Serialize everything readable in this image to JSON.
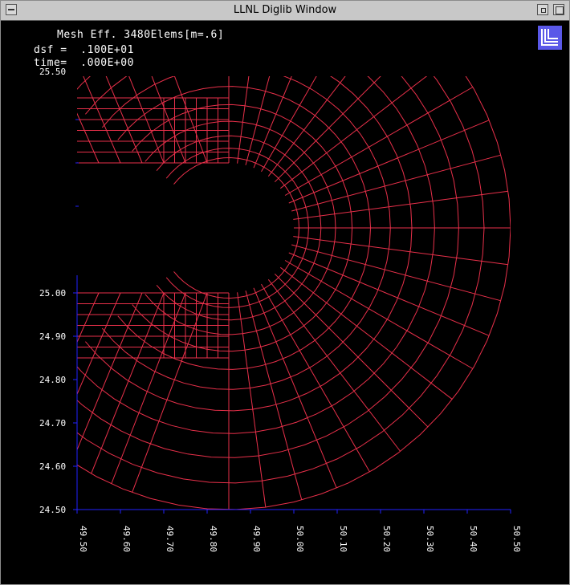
{
  "window": {
    "title": "LLNL Diglib Window"
  },
  "info": {
    "line1": "Mesh Eff. 3480Elems[m=.6]",
    "line2": "dsf =  .100E+01",
    "line3": "time=  .000E+00",
    "partial_label": "25.50"
  },
  "colors": {
    "background": "#000000",
    "mesh": "#e8304a",
    "axes": "#2222ff",
    "tick_labels": "#ffffff",
    "logo": "#5a58e8"
  },
  "icons": [
    "window-menu-icon",
    "minimize-icon",
    "maximize-icon",
    "llnl-logo-icon"
  ],
  "chart_data": {
    "type": "mesh",
    "title": "Mesh Eff. 3480Elems[m=.6]",
    "xlim": [
      49.5,
      50.5
    ],
    "ylim": [
      24.5,
      25.5
    ],
    "x_ticks": [
      "49.50",
      "49.60",
      "49.70",
      "49.80",
      "49.90",
      "50.00",
      "50.10",
      "50.20",
      "50.30",
      "50.40",
      "50.50"
    ],
    "y_ticks": [
      "24.50",
      "24.60",
      "24.70",
      "24.80",
      "24.90",
      "25.00"
    ],
    "crack_tip": [
      50.0,
      25.15
    ],
    "notch_half_width": 0.15,
    "notch_x_start": 49.5,
    "crack_tip_center_x": 49.85,
    "structured_block": {
      "x": [
        49.7,
        49.85
      ],
      "y": [
        24.85,
        25.45
      ]
    },
    "outer_radius": 0.65,
    "radial_rings": 12,
    "spokes": 24
  }
}
